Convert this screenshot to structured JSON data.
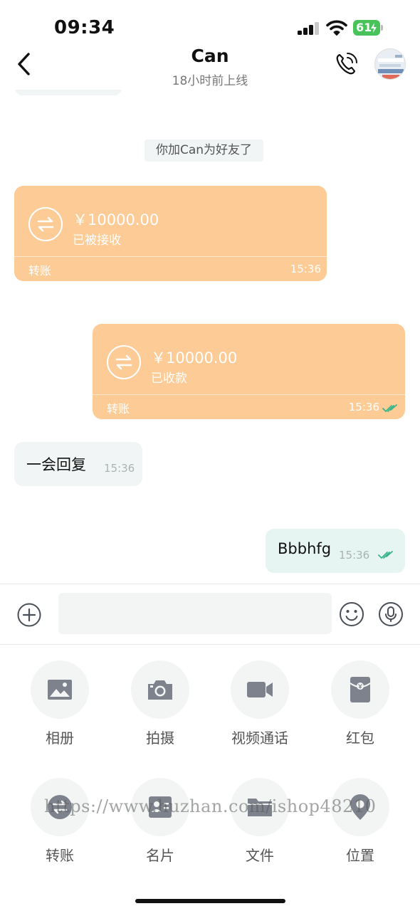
{
  "status_bar": {
    "time": "09:34",
    "battery": "61"
  },
  "header": {
    "title": "Can",
    "subtitle": "18小时前上线"
  },
  "system_message": "你加Can为好友了",
  "messages": {
    "transfer_received": {
      "amount": "￥10000.00",
      "status": "已被接收",
      "kind": "转账",
      "time": "15:36"
    },
    "transfer_sent": {
      "amount": "￥10000.00",
      "status": "已收款",
      "kind": "转账",
      "time": "15:36"
    },
    "text_incoming": {
      "text": "一会回复",
      "time": "15:36"
    },
    "text_outgoing": {
      "text": "Bbbhfg",
      "time": "15:36"
    }
  },
  "input": {
    "placeholder": ""
  },
  "tools": [
    {
      "label": "相册",
      "icon": "photo-album-icon"
    },
    {
      "label": "拍摄",
      "icon": "camera-icon"
    },
    {
      "label": "视频通话",
      "icon": "video-call-icon"
    },
    {
      "label": "红包",
      "icon": "red-packet-icon"
    },
    {
      "label": "转账",
      "icon": "transfer-icon"
    },
    {
      "label": "名片",
      "icon": "contact-card-icon"
    },
    {
      "label": "文件",
      "icon": "folder-icon"
    },
    {
      "label": "位置",
      "icon": "location-icon"
    }
  ],
  "watermark": "https://www.huzhan.com/ishop48210",
  "colors": {
    "transfer_bubble": "#fdcb96",
    "incoming_bubble": "#f2f5f5",
    "outgoing_bubble": "#e6f5f1",
    "read_check": "#38b48b",
    "battery": "#48c35a",
    "icon_gray": "#7d828c"
  }
}
